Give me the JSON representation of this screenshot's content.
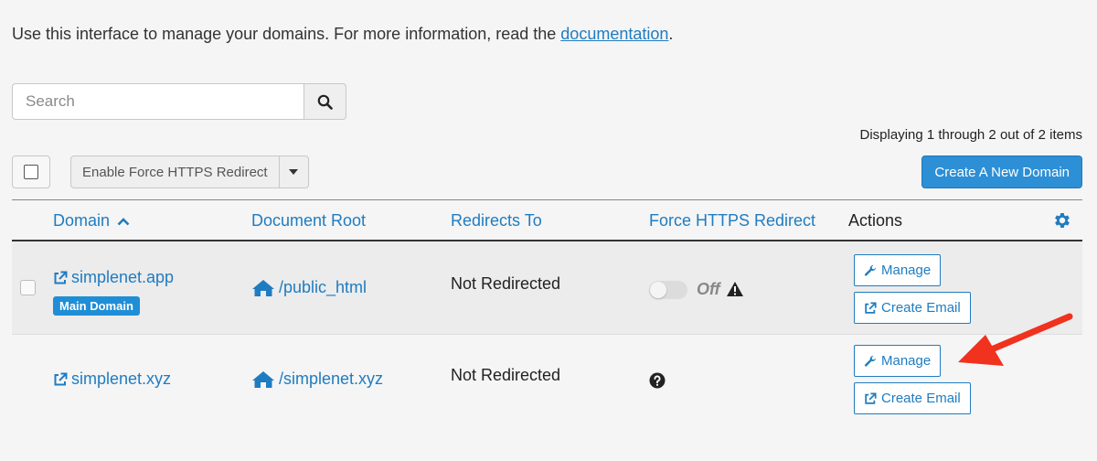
{
  "intro": {
    "text": "Use this interface to manage your domains. For more information, read the ",
    "link": "documentation",
    "suffix": "."
  },
  "search": {
    "placeholder": "Search"
  },
  "display_count": "Displaying 1 through 2 out of 2 items",
  "toolbar": {
    "bulk_action": "Enable Force HTTPS Redirect",
    "create_label": "Create A New Domain"
  },
  "table": {
    "headers": {
      "domain": "Domain",
      "docroot": "Document Root",
      "redirects": "Redirects To",
      "force_https": "Force HTTPS Redirect",
      "actions": "Actions"
    },
    "rows": [
      {
        "domain": "simplenet.app",
        "badge": "Main Domain",
        "docroot": "/public_html",
        "redirects": "Not Redirected",
        "https_state": "Off",
        "manage": "Manage",
        "create_email": "Create Email"
      },
      {
        "domain": "simplenet.xyz",
        "docroot": "/simplenet.xyz",
        "redirects": "Not Redirected",
        "manage": "Manage",
        "create_email": "Create Email"
      }
    ]
  },
  "colors": {
    "link": "#1f7cc1",
    "primary_button": "#2d8fd5",
    "annotation_arrow": "#f0321e"
  }
}
